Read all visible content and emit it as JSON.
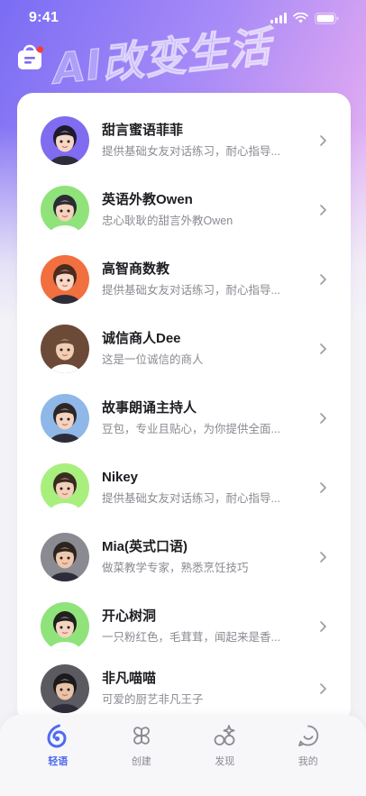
{
  "status_bar": {
    "time": "9:41"
  },
  "hero": {
    "slogan": "AI改变生活"
  },
  "assistants": [
    {
      "name": "甜言蜜语菲菲",
      "desc": "提供基础女友对话练习，耐心指导..."
    },
    {
      "name": "英语外教Owen",
      "desc": "忠心耿耿的甜言外教Owen"
    },
    {
      "name": "高智商数教",
      "desc": "提供基础女友对话练习，耐心指导..."
    },
    {
      "name": "诚信商人Dee",
      "desc": "这是一位诚信的商人"
    },
    {
      "name": "故事朗诵主持人",
      "desc": "豆包，专业且贴心，为你提供全面..."
    },
    {
      "name": "Nikey",
      "desc": "提供基础女友对话练习，耐心指导..."
    },
    {
      "name": "Mia(英式口语)",
      "desc": "做菜教学专家，熟悉烹饪技巧"
    },
    {
      "name": "开心树洞",
      "desc": "一只粉红色，毛茸茸，闻起来是香..."
    },
    {
      "name": "非凡喵喵",
      "desc": "可爱的厨艺非凡王子"
    }
  ],
  "avatar_colors": [
    "#7f6cf0",
    "#8fe37a",
    "#f26f3f",
    "#6b4a38",
    "#8fb7e8",
    "#a8ef7e",
    "#8a8a92",
    "#8fe37a",
    "#5a5a60"
  ],
  "tabs": [
    {
      "label": "轻语",
      "icon": "chat-swirl-icon",
      "active": true
    },
    {
      "label": "创建",
      "icon": "clover-icon",
      "active": false
    },
    {
      "label": "发现",
      "icon": "discover-shapes-icon",
      "active": false
    },
    {
      "label": "我的",
      "icon": "smile-bubble-icon",
      "active": false
    }
  ],
  "colors": {
    "accent": "#4f6af0",
    "badge": "#ff3b30"
  }
}
